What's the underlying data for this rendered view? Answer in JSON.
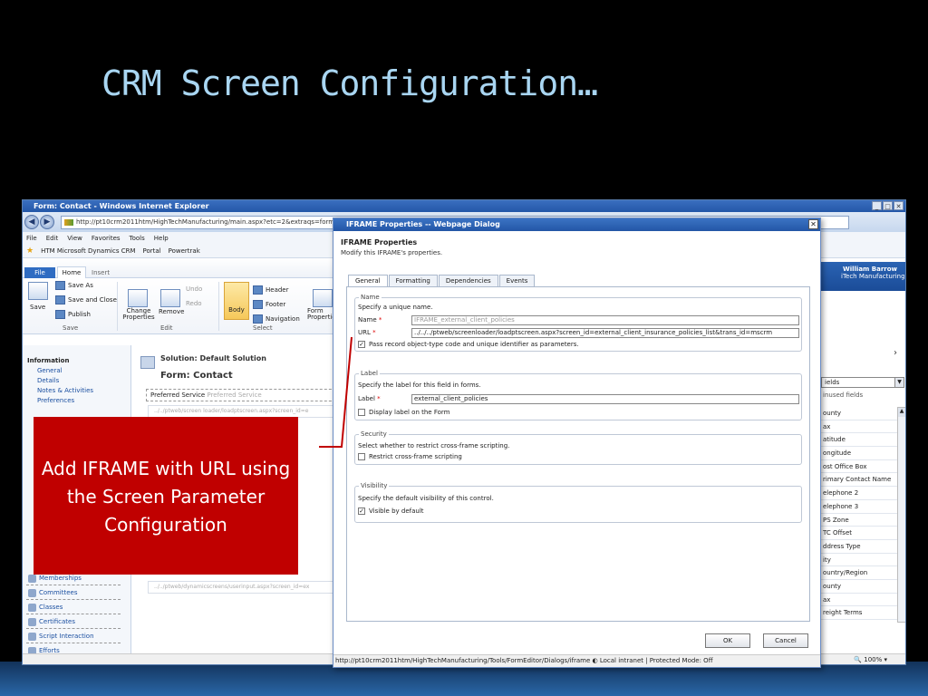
{
  "slide": {
    "title": "CRM Screen Configuration…"
  },
  "ie": {
    "window_title": "Form: Contact - Windows Internet Explorer",
    "url": "http://pt10crm2011htm/HighTechManufacturing/main.aspx?etc=2&extraqs=formtype=",
    "menu": [
      "File",
      "Edit",
      "View",
      "Favorites",
      "Tools",
      "Help"
    ],
    "favorites": [
      "HTM Microsoft Dynamics CRM",
      "Portal",
      "Powertrak"
    ],
    "zoom": "100%"
  },
  "ribbon": {
    "tabs": {
      "file": "File",
      "home": "Home",
      "insert": "Insert"
    },
    "save": "Save",
    "save_as": "Save As",
    "save_close": "Save and Close",
    "publish": "Publish",
    "change_props": "Change Properties",
    "remove": "Remove",
    "undo": "Undo",
    "redo": "Redo",
    "body": "Body",
    "header": "Header",
    "footer": "Footer",
    "navigation": "Navigation",
    "form_props": "Form Properties",
    "groups": {
      "save": "Save",
      "edit": "Edit",
      "select": "Select"
    }
  },
  "leftnav": {
    "header": "Information",
    "items": [
      "General",
      "Details",
      "Notes & Activities",
      "Preferences"
    ],
    "entries": [
      "Memberships",
      "Committees",
      "Classes",
      "Certificates",
      "Script Interaction",
      "Efforts"
    ]
  },
  "canvas": {
    "solution": "Solution: Default Solution",
    "form": "Form: Contact",
    "preferred": "Preferred Service",
    "preferred_ph": "Preferred Service",
    "iframe_url1": "../../ptweb/screen loader/loadptscreen.aspx?screen_id=e",
    "iframe_url2": "../../ptweb/dynamicscreens/userinput.aspx?screen_id=ex"
  },
  "right": {
    "user": "William Barrow",
    "org": "iTech Manufacturing",
    "fields": "ields",
    "unused": "inused fields",
    "list": [
      "ounty",
      "ax",
      "atitude",
      "ongitude",
      "ost Office Box",
      "rimary Contact Name",
      "elephone 2",
      "elephone 3",
      "PS Zone",
      "TC Offset",
      "ddress Type",
      "ity",
      "ountry/Region",
      "ounty",
      "ax",
      "reight Terms"
    ]
  },
  "dialog": {
    "title": "IFRAME Properties -- Webpage Dialog",
    "heading": "IFRAME Properties",
    "subheading": "Modify this IFRAME's properties.",
    "tabs": [
      "General",
      "Formatting",
      "Dependencies",
      "Events"
    ],
    "name_section": "Name",
    "name_hint": "Specify a unique name.",
    "name_label": "Name",
    "name_value": "IFRAME_external_client_policies",
    "url_label": "URL",
    "url_value": "../../../ptweb/screenloader/loadptscreen.aspx?screen_id=external_client_insurance_policies_list&trans_id=mscrm",
    "pass_record": "Pass record object-type code and unique identifier as parameters.",
    "label_section": "Label",
    "label_hint": "Specify the label for this field in forms.",
    "label_label": "Label",
    "label_value": "external_client_policies",
    "display_label": "Display label on the Form",
    "security_section": "Security",
    "security_hint": "Select whether to restrict cross-frame scripting.",
    "restrict": "Restrict cross-frame scripting",
    "visibility_section": "Visibility",
    "visibility_hint": "Specify the default visibility of this control.",
    "visible": "Visible by default",
    "ok": "OK",
    "cancel": "Cancel",
    "status": "http://pt10crm2011htm/HighTechManufacturing/Tools/FormEditor/Dialogs/iframe",
    "zone": "Local intranet | Protected Mode: Off"
  },
  "callout": {
    "text": "Add IFRAME with URL using the Screen Parameter Configuration"
  },
  "colors": {
    "callout": "#c00000",
    "title": "#a9d6f2"
  }
}
